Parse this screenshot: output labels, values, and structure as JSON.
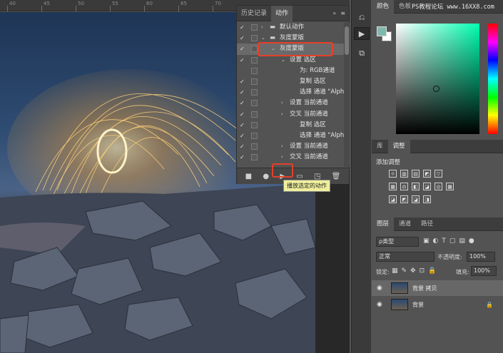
{
  "ruler": {
    "numbers": [
      "40",
      "45",
      "50",
      "55",
      "60",
      "65",
      "70"
    ]
  },
  "actions_panel": {
    "tabs": [
      "历史记录",
      "动作"
    ],
    "menu_glyphs": [
      "»",
      "≡"
    ],
    "rows": [
      {
        "check": "✓",
        "tri": "›",
        "icon": "folder",
        "label": "默认动作",
        "indent": 1
      },
      {
        "check": "✓",
        "tri": "⌄",
        "icon": "folder",
        "label": "灰度蒙版",
        "indent": 1
      },
      {
        "check": "✓",
        "tri": "⌄",
        "icon": "",
        "label": "灰度蒙版",
        "indent": 2,
        "selected": true
      },
      {
        "check": "✓",
        "tri": "⌄",
        "icon": "",
        "label": "设置 选区",
        "indent": 3
      },
      {
        "check": "",
        "tri": "",
        "icon": "",
        "label": "为: RGB通道",
        "indent": 4
      },
      {
        "check": "✓",
        "tri": "",
        "icon": "",
        "label": "复制 选区",
        "indent": 4
      },
      {
        "check": "✓",
        "tri": "",
        "icon": "",
        "label": "选择 通道 \"Alph...",
        "indent": 4
      },
      {
        "check": "✓",
        "tri": "›",
        "icon": "",
        "label": "设置 当前通道",
        "indent": 3
      },
      {
        "check": "✓",
        "tri": "›",
        "icon": "",
        "label": "交叉 当前通道",
        "indent": 3
      },
      {
        "check": "✓",
        "tri": "",
        "icon": "",
        "label": "复制 选区",
        "indent": 4
      },
      {
        "check": "✓",
        "tri": "",
        "icon": "",
        "label": "选择 通道 \"Alph...",
        "indent": 4
      },
      {
        "check": "✓",
        "tri": "›",
        "icon": "",
        "label": "设置 当前通道",
        "indent": 3
      },
      {
        "check": "✓",
        "tri": "›",
        "icon": "",
        "label": "交叉 当前通道",
        "indent": 3
      }
    ],
    "bottom_buttons": [
      "■",
      "●",
      "▶",
      "▭",
      "◳",
      "🗑"
    ],
    "tooltip": "播放选定的动作"
  },
  "watermark": "PS教程论坛 www.16XX8.com",
  "color_panel": {
    "tabs": [
      "颜色",
      "色板"
    ],
    "fg": "#7fb9ae",
    "bg": "#ffffff"
  },
  "adjust_panel": {
    "tabs": [
      "库",
      "调整"
    ],
    "title": "添加调整",
    "rows": [
      [
        "☼",
        "▥",
        "▤",
        "◩",
        "▽"
      ],
      [
        "▦",
        "⚖",
        "◧",
        "◪",
        "◎",
        "▦"
      ],
      [
        "◪",
        "◩",
        "◪",
        "◨"
      ]
    ]
  },
  "layers_panel": {
    "tabs": [
      "图层",
      "通道",
      "路径"
    ],
    "filter": "ρ类型",
    "blend_mode": "正常",
    "opacity_label": "不透明度:",
    "opacity": "100%",
    "lock_label": "锁定:",
    "fill_label": "填充:",
    "fill": "100%",
    "layers": [
      {
        "name": "背景 拷贝",
        "locked": false
      },
      {
        "name": "背景",
        "locked": true
      }
    ]
  }
}
